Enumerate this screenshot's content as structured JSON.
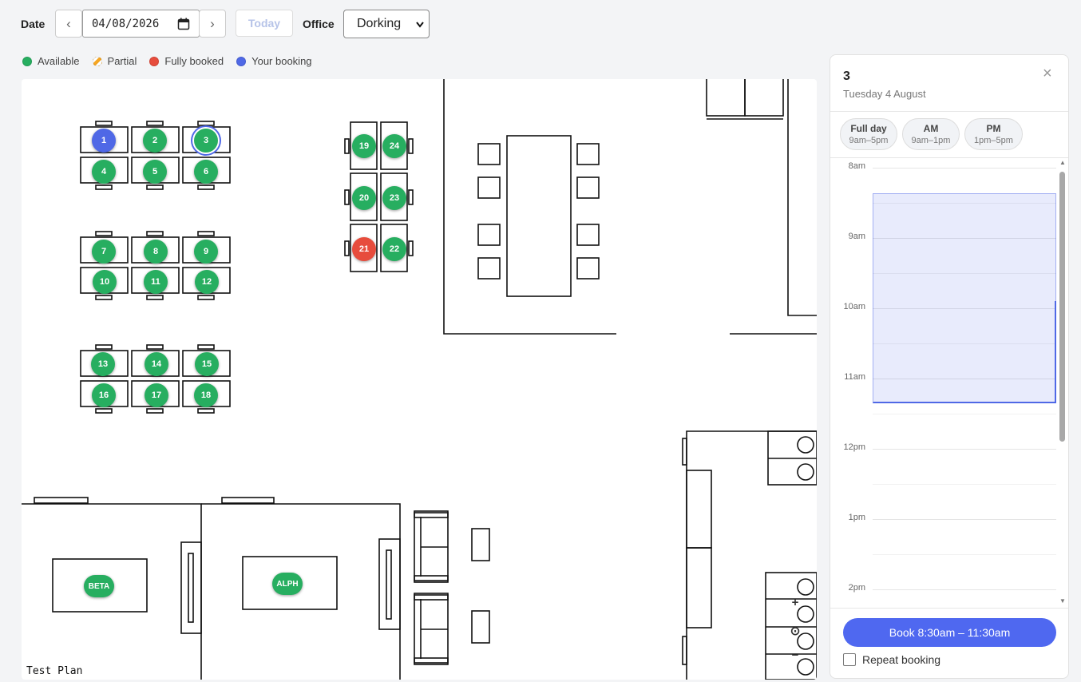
{
  "toolbar": {
    "date_label": "Date",
    "prev_symbol": "‹",
    "next_symbol": "›",
    "date_value": "04/08/2026",
    "today_label": "Today",
    "office_label": "Office",
    "office_value": "Dorking"
  },
  "legend": [
    {
      "label": "Available",
      "color": "#27ae60"
    },
    {
      "label": "Partial",
      "color": "#f5a623"
    },
    {
      "label": "Fully booked",
      "color": "#e74c3c"
    },
    {
      "label": "Your booking",
      "color": "#4f68e6"
    }
  ],
  "colors": {
    "available": "#27ae60",
    "booked": "#e74c3c",
    "mine": "#4f68e6",
    "accent": "#4f68f0"
  },
  "floorplan": {
    "seats": [
      {
        "label": "1",
        "status": "mine"
      },
      {
        "label": "2",
        "status": "available"
      },
      {
        "label": "3",
        "status": "available",
        "selected": true
      },
      {
        "label": "4",
        "status": "available"
      },
      {
        "label": "5",
        "status": "available"
      },
      {
        "label": "6",
        "status": "available"
      },
      {
        "label": "7",
        "status": "available"
      },
      {
        "label": "8",
        "status": "available"
      },
      {
        "label": "9",
        "status": "available"
      },
      {
        "label": "10",
        "status": "available"
      },
      {
        "label": "11",
        "status": "available"
      },
      {
        "label": "12",
        "status": "available"
      },
      {
        "label": "13",
        "status": "available"
      },
      {
        "label": "14",
        "status": "available"
      },
      {
        "label": "15",
        "status": "available"
      },
      {
        "label": "16",
        "status": "available"
      },
      {
        "label": "17",
        "status": "available"
      },
      {
        "label": "18",
        "status": "available"
      },
      {
        "label": "19",
        "status": "available"
      },
      {
        "label": "24",
        "status": "available"
      },
      {
        "label": "20",
        "status": "available"
      },
      {
        "label": "23",
        "status": "available"
      },
      {
        "label": "21",
        "status": "booked"
      },
      {
        "label": "22",
        "status": "available"
      }
    ],
    "rooms": [
      {
        "label": "BETA",
        "status": "available"
      },
      {
        "label": "ALPH",
        "status": "available"
      }
    ],
    "plan_name": "Test Plan",
    "zoom": {
      "in": "+",
      "reset": "⊙",
      "out": "−"
    }
  },
  "panel": {
    "title": "3",
    "subtitle": "Tuesday 4 August",
    "close_icon": "×",
    "presets": [
      {
        "label": "Full day",
        "range": "9am–5pm"
      },
      {
        "label": "AM",
        "range": "9am–1pm"
      },
      {
        "label": "PM",
        "range": "1pm–5pm"
      }
    ],
    "hours": [
      "8am",
      "9am",
      "10am",
      "11am",
      "12pm",
      "1pm",
      "2pm"
    ],
    "book_label": "Book 8:30am – 11:30am",
    "repeat_label": "Repeat booking"
  }
}
